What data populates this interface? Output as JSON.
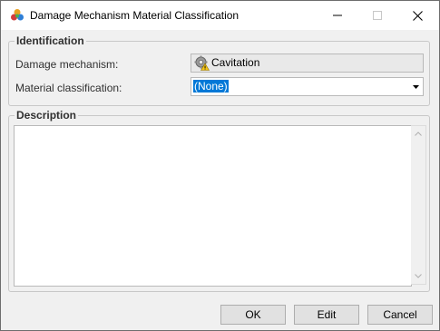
{
  "window": {
    "title": "Damage Mechanism Material Classification",
    "app_icon": "colored-cubes-icon"
  },
  "title_controls": {
    "minimize_icon": "minimize-icon",
    "maximize_icon": "maximize-icon",
    "close_icon": "close-icon"
  },
  "identification": {
    "group_title": "Identification",
    "damage_mechanism_label": "Damage mechanism:",
    "damage_mechanism_value": "Cavitation",
    "damage_mechanism_icon": "gear-warning-icon",
    "material_classification_label": "Material classification:",
    "material_classification_value": "(None)"
  },
  "description": {
    "group_title": "Description",
    "value": ""
  },
  "buttons": {
    "ok": "OK",
    "edit": "Edit",
    "cancel": "Cancel"
  },
  "colors": {
    "selection": "#0078d7",
    "dialog_bg": "#f0f0f0"
  }
}
